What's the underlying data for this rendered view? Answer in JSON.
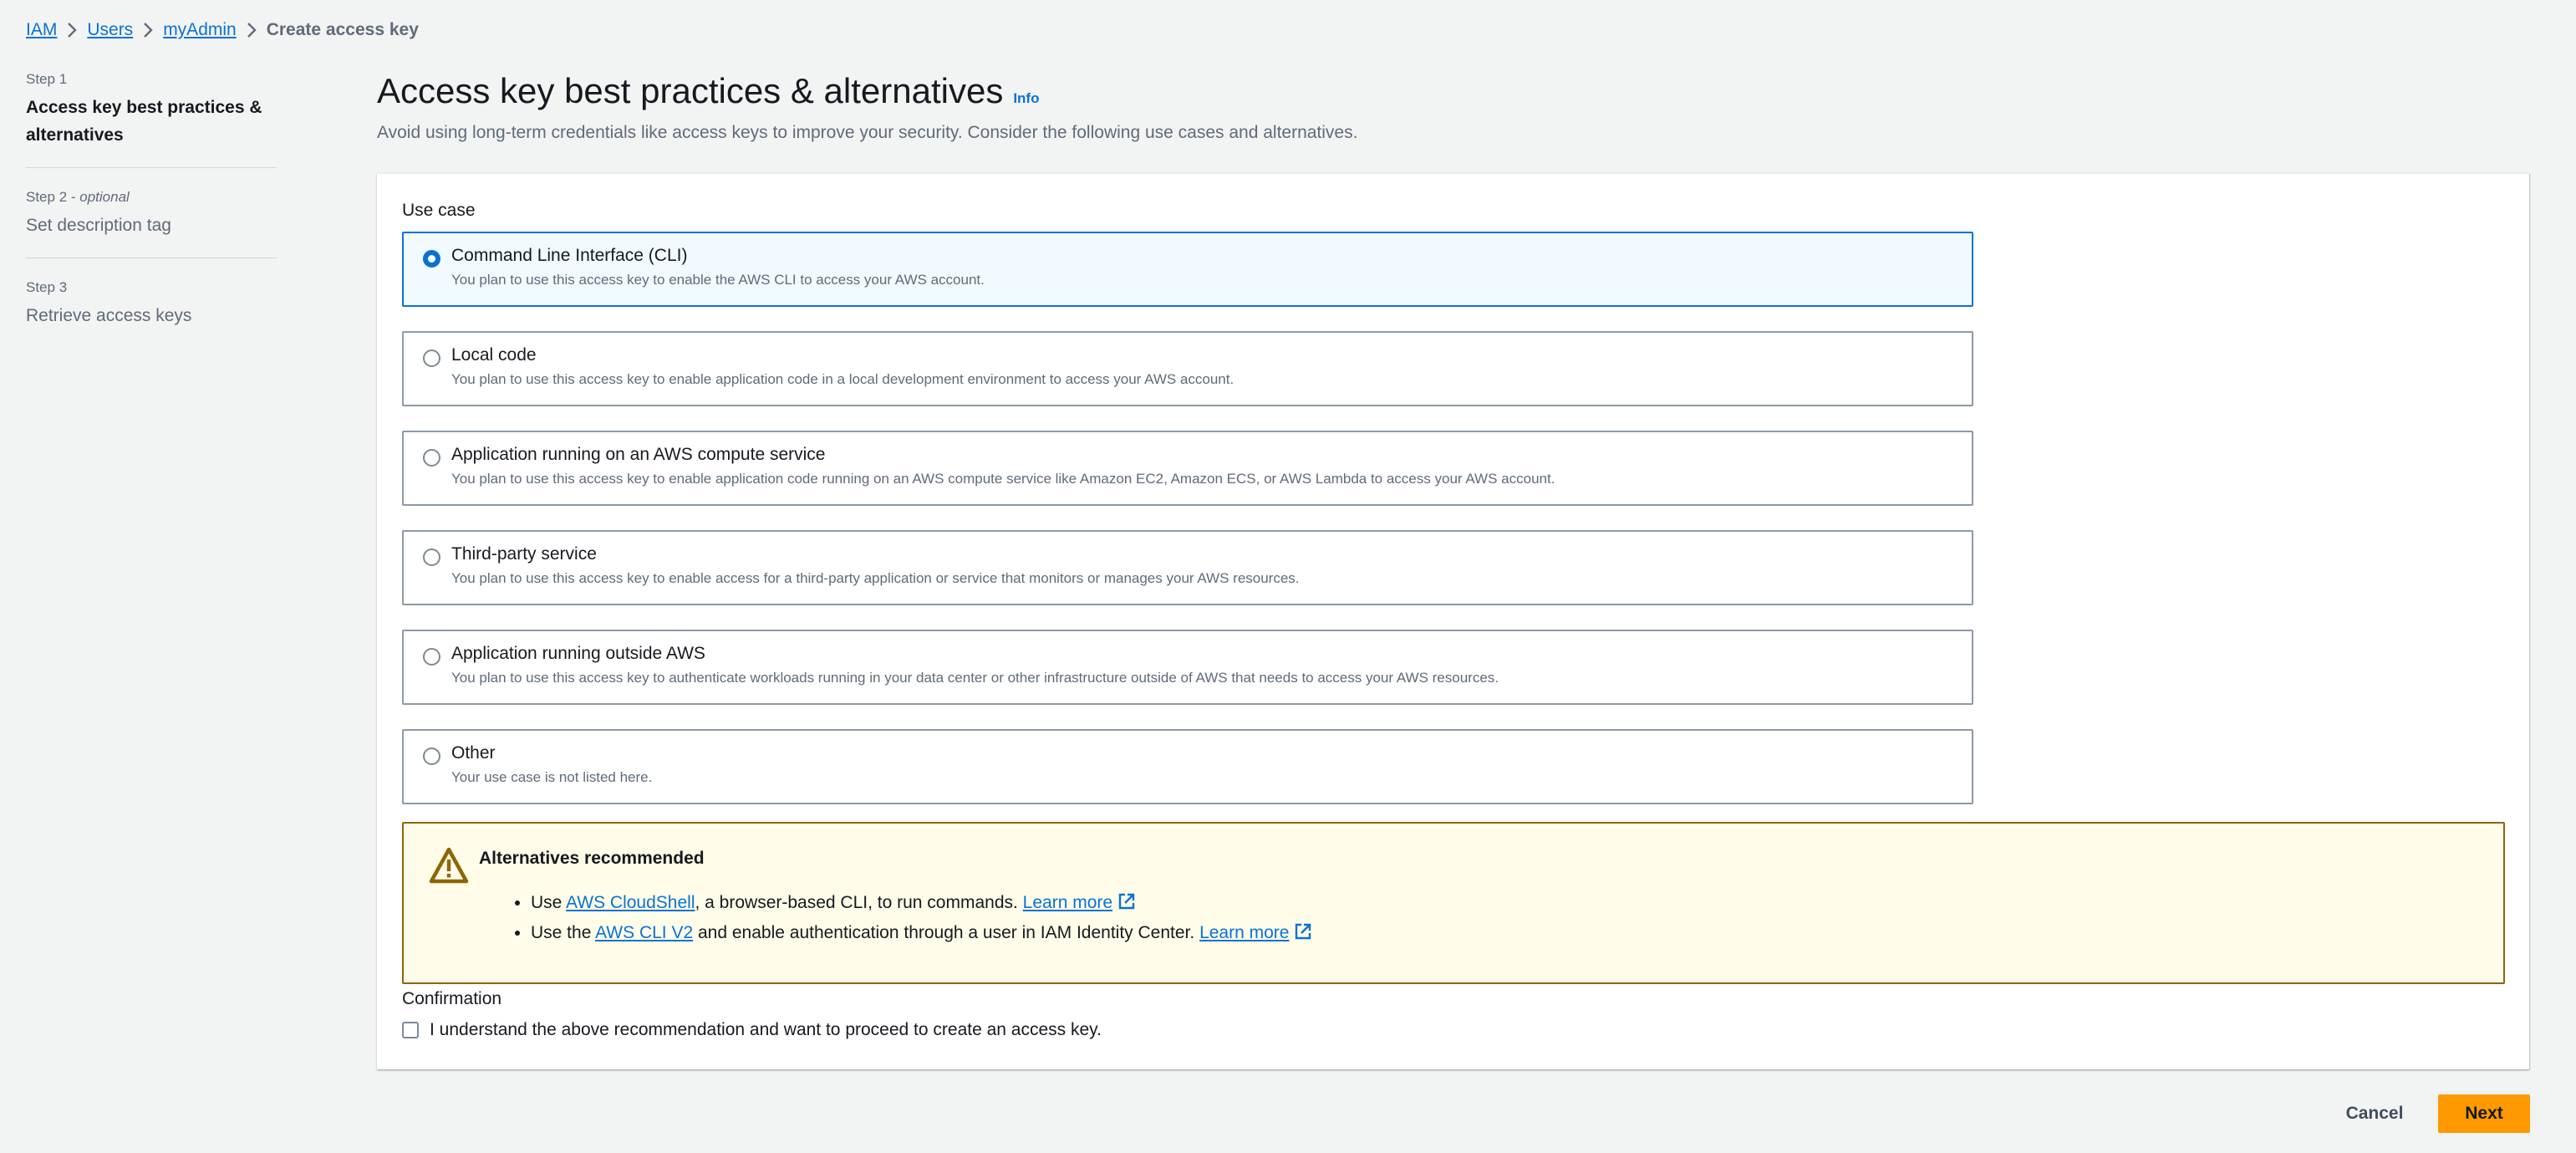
{
  "breadcrumb": {
    "items": [
      "IAM",
      "Users",
      "myAdmin"
    ],
    "current": "Create access key"
  },
  "steps": [
    {
      "number": "Step 1",
      "optional": "",
      "title": "Access key best practices & alternatives",
      "active": true
    },
    {
      "number": "Step 2 - ",
      "optional": "optional",
      "title": "Set description tag",
      "active": false
    },
    {
      "number": "Step 3",
      "optional": "",
      "title": "Retrieve access keys",
      "active": false
    }
  ],
  "header": {
    "title": "Access key best practices & alternatives",
    "info": "Info",
    "description": "Avoid using long-term credentials like access keys to improve your security. Consider the following use cases and alternatives."
  },
  "use_case": {
    "label": "Use case",
    "selected": "Command Line Interface (CLI)",
    "options": [
      {
        "title": "Command Line Interface (CLI)",
        "description": "You plan to use this access key to enable the AWS CLI to access your AWS account."
      },
      {
        "title": "Local code",
        "description": "You plan to use this access key to enable application code in a local development environment to access your AWS account."
      },
      {
        "title": "Application running on an AWS compute service",
        "description": "You plan to use this access key to enable application code running on an AWS compute service like Amazon EC2, Amazon ECS, or AWS Lambda to access your AWS account."
      },
      {
        "title": "Third-party service",
        "description": "You plan to use this access key to enable access for a third-party application or service that monitors or manages your AWS resources."
      },
      {
        "title": "Application running outside AWS",
        "description": "You plan to use this access key to authenticate workloads running in your data center or other infrastructure outside of AWS that needs to access your AWS resources."
      },
      {
        "title": "Other",
        "description": "Your use case is not listed here."
      }
    ]
  },
  "alert": {
    "title": "Alternatives recommended",
    "items": [
      {
        "prefix": "Use ",
        "link": "AWS CloudShell",
        "suffix": ", a browser-based CLI, to run commands. ",
        "learn_more": "Learn more"
      },
      {
        "prefix": "Use the ",
        "link": "AWS CLI V2",
        "suffix": " and enable authentication through a user in IAM Identity Center. ",
        "learn_more": "Learn more"
      }
    ]
  },
  "confirmation": {
    "label": "Confirmation",
    "checkbox_text": "I understand the above recommendation and want to proceed to create an access key.",
    "checked": false
  },
  "footer": {
    "cancel": "Cancel",
    "next": "Next"
  },
  "colors": {
    "link": "#0972d3",
    "primary_button": "#ff9900",
    "warning_bg": "#fffce9",
    "warning_border": "#8d6605",
    "selected_bg": "#f1faff"
  }
}
